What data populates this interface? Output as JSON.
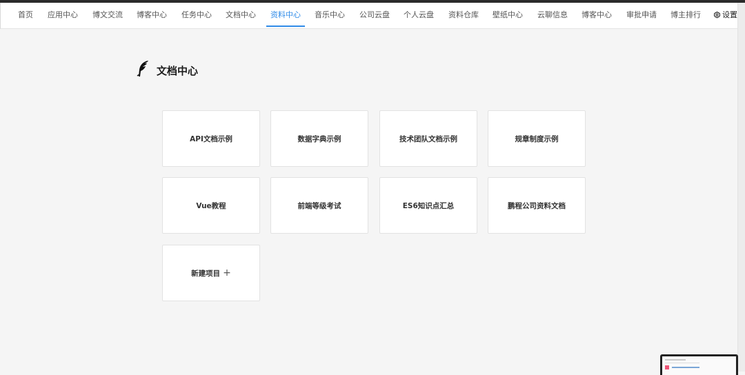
{
  "nav": {
    "items": [
      {
        "label": "首页",
        "active": false
      },
      {
        "label": "应用中心",
        "active": false
      },
      {
        "label": "博文交流",
        "active": false
      },
      {
        "label": "博客中心",
        "active": false
      },
      {
        "label": "任务中心",
        "active": false
      },
      {
        "label": "文档中心",
        "active": false
      },
      {
        "label": "资料中心",
        "active": true
      },
      {
        "label": "音乐中心",
        "active": false
      },
      {
        "label": "公司云盘",
        "active": false
      },
      {
        "label": "个人云盘",
        "active": false
      },
      {
        "label": "资料仓库",
        "active": false
      },
      {
        "label": "壁纸中心",
        "active": false
      },
      {
        "label": "云聊信息",
        "active": false
      },
      {
        "label": "博客中心",
        "active": false
      },
      {
        "label": "审批申请",
        "active": false
      },
      {
        "label": "博主排行",
        "active": false
      }
    ],
    "settings_label": "设置",
    "active_color": "#2f8be8"
  },
  "page": {
    "title": "文档中心",
    "logo_icon": "feather-icon"
  },
  "cards": [
    {
      "label": "API文档示例"
    },
    {
      "label": "数据字典示例"
    },
    {
      "label": "技术团队文档示例"
    },
    {
      "label": "规章制度示例"
    },
    {
      "label": "Vue教程"
    },
    {
      "label": "前端等级考试"
    },
    {
      "label": "ES6知识点汇总"
    },
    {
      "label": "鹏程公司资料文档"
    }
  ],
  "new_project": {
    "label": "新建项目",
    "icon": "plus-icon"
  }
}
